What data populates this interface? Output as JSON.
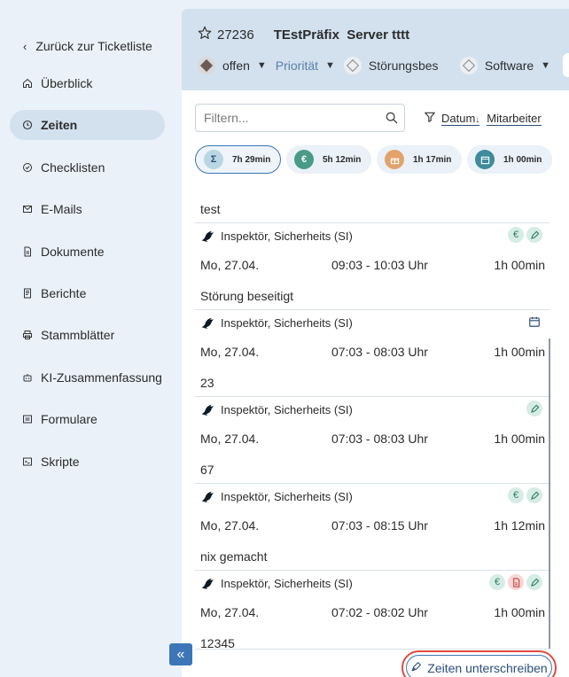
{
  "sidebar": {
    "back_label": "Zurück zur Ticketliste",
    "items": [
      {
        "label": "Überblick",
        "icon": "home-icon",
        "active": false
      },
      {
        "label": "Zeiten",
        "icon": "clock-icon",
        "active": true
      },
      {
        "label": "Checklisten",
        "icon": "checklist-icon",
        "active": false
      },
      {
        "label": "E-Mails",
        "icon": "mail-icon",
        "active": false
      },
      {
        "label": "Dokumente",
        "icon": "document-icon",
        "active": false
      },
      {
        "label": "Berichte",
        "icon": "report-icon",
        "active": false
      },
      {
        "label": "Stammblätter",
        "icon": "printer-icon",
        "active": false
      },
      {
        "label": "KI-Zusammenfassung",
        "icon": "robot-icon",
        "active": false
      },
      {
        "label": "Formulare",
        "icon": "form-icon",
        "active": false
      },
      {
        "label": "Skripte",
        "icon": "terminal-icon",
        "active": false
      }
    ],
    "collapse_icon": "double-chevron-left-icon"
  },
  "header": {
    "ticket_id": "27236",
    "title": "TEstPräfix  Server tttt",
    "status": "offen",
    "priority": "Priorität",
    "category": "Störungsbes",
    "type": "Software",
    "overflow": "0"
  },
  "filter": {
    "placeholder": "Filtern...",
    "sort_label": "Datum",
    "sort_arrow": "↓",
    "group_label": "Mitarbeiter"
  },
  "summary": [
    {
      "label": "7h 29min",
      "icon": "Σ",
      "color": "#b8d7e2",
      "active": true
    },
    {
      "label": "5h 12min",
      "icon": "€",
      "color": "#4a9a88",
      "active": false
    },
    {
      "label": "1h 17min",
      "icon": "gift-icon",
      "color": "#e3a26a",
      "active": false
    },
    {
      "label": "1h 00min",
      "icon": "calendar-icon",
      "color": "#3f8a9c",
      "active": false
    }
  ],
  "entries": [
    {
      "title": "test",
      "user": "Inspektör, Sicherheits (SI)",
      "badges": [
        "euro",
        "sign"
      ],
      "date": "Mo, 27.04.",
      "span": "09:03 - 10:03 Uhr",
      "duration": "1h 00min"
    },
    {
      "title": "Störung beseitigt",
      "user": "Inspektör, Sicherheits (SI)",
      "badges": [
        "calendar"
      ],
      "date": "Mo, 27.04.",
      "span": "07:03 - 08:03 Uhr",
      "duration": "1h 00min"
    },
    {
      "title": "23",
      "user": "Inspektör, Sicherheits (SI)",
      "badges": [
        "sign"
      ],
      "date": "Mo, 27.04.",
      "span": "07:03 - 08:03 Uhr",
      "duration": "1h 00min"
    },
    {
      "title": "67",
      "user": "Inspektör, Sicherheits (SI)",
      "badges": [
        "euro",
        "sign"
      ],
      "date": "Mo, 27.04.",
      "span": "07:03 - 08:15 Uhr",
      "duration": "1h 12min"
    },
    {
      "title": "nix gemacht",
      "user": "Inspektör, Sicherheits (SI)",
      "badges": [
        "euro",
        "pdf",
        "sign"
      ],
      "date": "Mo, 27.04.",
      "span": "07:02 - 08:02 Uhr",
      "duration": "1h 00min"
    }
  ],
  "last_entry_title": "12345",
  "sign_button": "Zeiten unterschreiben",
  "colors": {
    "accent": "#3c76b8",
    "highlight": "#e04a3f",
    "sidebar_bg": "#eaf1f8",
    "header_bg": "#d3e1ef"
  }
}
